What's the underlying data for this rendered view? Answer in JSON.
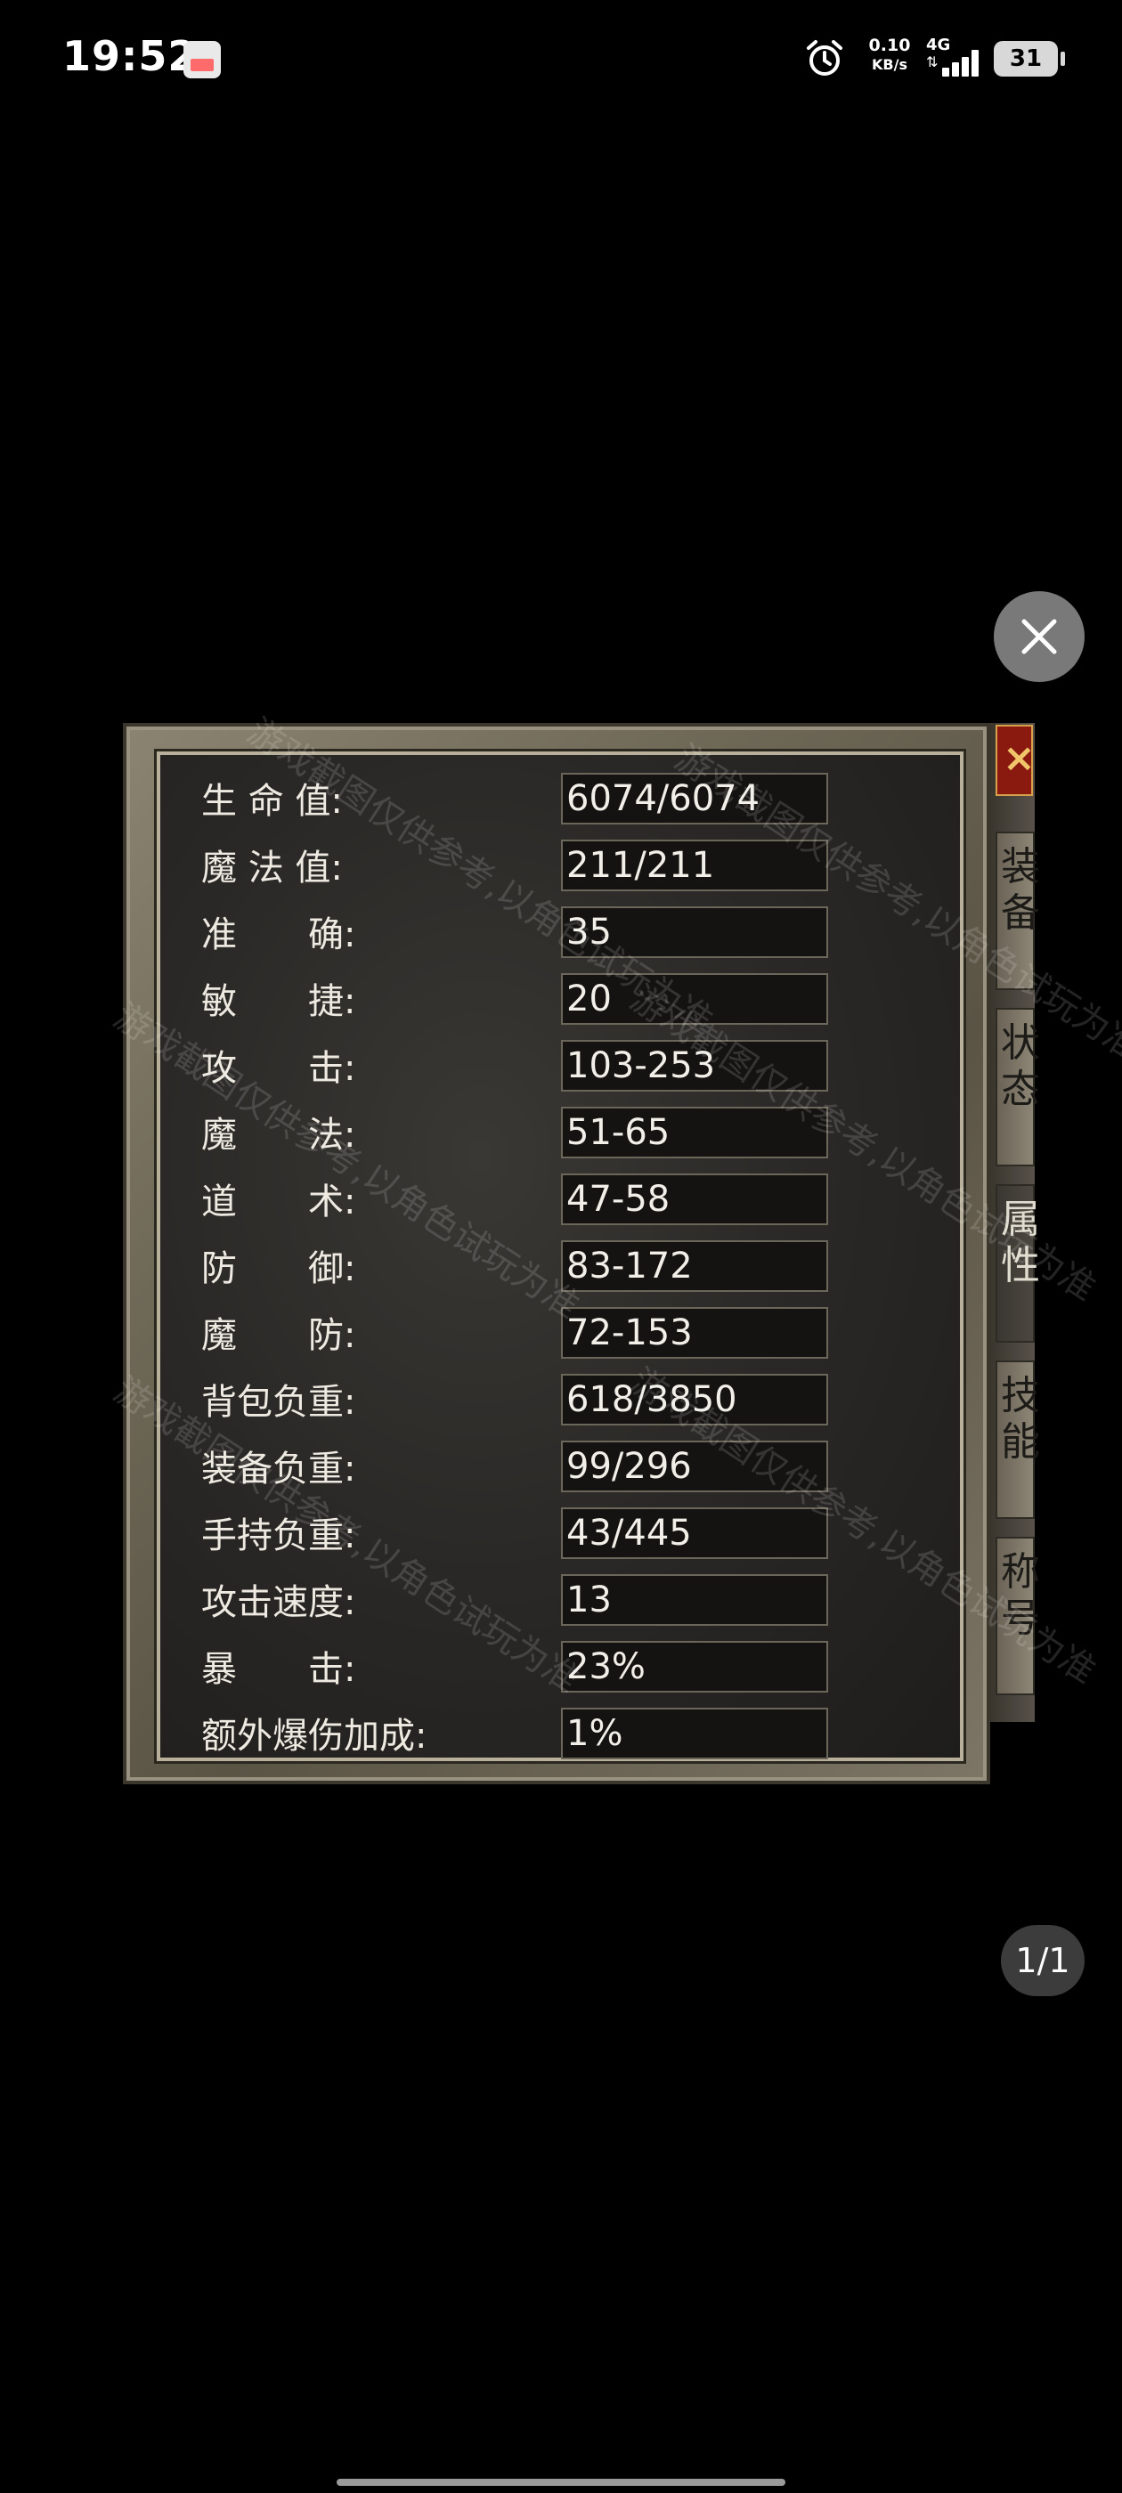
{
  "status_bar": {
    "time": "19:52",
    "net_speed_value": "0.10",
    "net_speed_unit": "KB/s",
    "network_type": "4G",
    "battery_level": "31"
  },
  "stats": [
    {
      "label": "生 命 值:",
      "value": "6074/6074"
    },
    {
      "label": "魔 法 值:",
      "value": "211/211"
    },
    {
      "label": "准　　确:",
      "value": "35"
    },
    {
      "label": "敏　　捷:",
      "value": "20"
    },
    {
      "label": "攻　　击:",
      "value": "103-253"
    },
    {
      "label": "魔　　法:",
      "value": "51-65"
    },
    {
      "label": "道　　术:",
      "value": "47-58"
    },
    {
      "label": "防　　御:",
      "value": "83-172"
    },
    {
      "label": "魔　　防:",
      "value": "72-153"
    },
    {
      "label": "背包负重:",
      "value": "618/3850"
    },
    {
      "label": "装备负重:",
      "value": "99/296"
    },
    {
      "label": "手持负重:",
      "value": "43/445"
    },
    {
      "label": "攻击速度:",
      "value": "13"
    },
    {
      "label": "暴　　击:",
      "value": "23%"
    },
    {
      "label": "额外爆伤加成:",
      "value": "1%"
    }
  ],
  "side_tabs": [
    {
      "label": "装备",
      "active": false
    },
    {
      "label": "状态",
      "active": false
    },
    {
      "label": "属性",
      "active": true
    },
    {
      "label": "技能",
      "active": false
    },
    {
      "label": "称号",
      "active": false
    }
  ],
  "side_close_label": "×",
  "watermark_text": "游戏截图仅供参考,以角色试玩为准",
  "page_indicator": "1/1"
}
